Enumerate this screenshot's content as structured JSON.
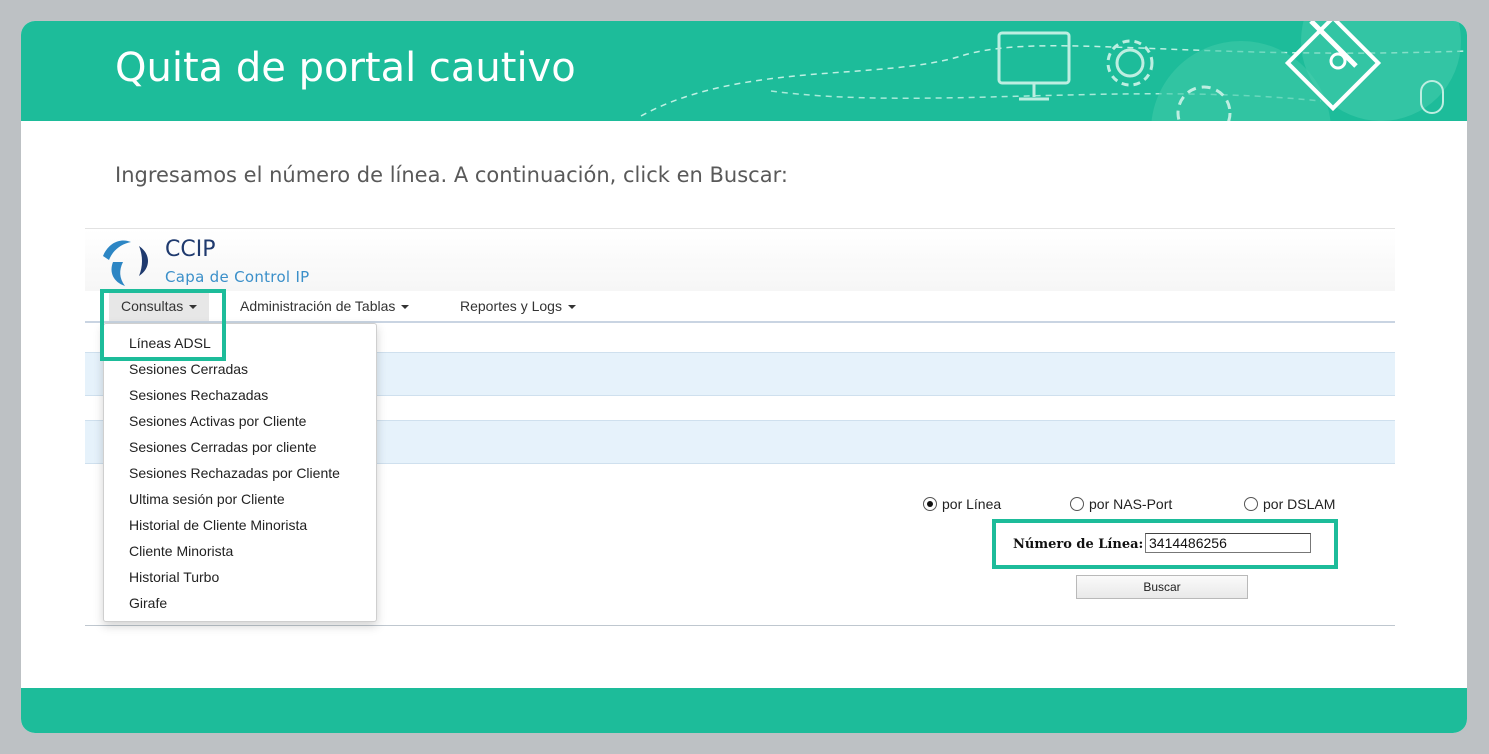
{
  "slide": {
    "title": "Quita de portal cautivo",
    "subtitle": "Ingresamos el número de línea. A continuación, click en Buscar:",
    "accent_color": "#1dbc9a"
  },
  "app": {
    "name": "CCIP",
    "tagline": "Capa de Control IP",
    "nav": [
      {
        "label": "Consultas"
      },
      {
        "label": "Administración de Tablas"
      },
      {
        "label": "Reportes y Logs"
      }
    ],
    "dropdown": [
      "Líneas ADSL",
      "Sesiones Cerradas",
      "Sesiones Rechazadas",
      "Sesiones Activas por Cliente",
      "Sesiones Cerradas por cliente",
      "Sesiones Rechazadas por Cliente",
      "Ultima sesión por Cliente",
      "Historial de Cliente Minorista",
      "Cliente Minorista",
      "Historial Turbo",
      "Girafe"
    ],
    "search": {
      "options": [
        {
          "label": "por Línea",
          "checked": true
        },
        {
          "label": "por NAS-Port",
          "checked": false
        },
        {
          "label": "por DSLAM",
          "checked": false
        }
      ],
      "field_label": "Número de Línea:",
      "field_value": "3414486256",
      "button_label": "Buscar"
    }
  }
}
